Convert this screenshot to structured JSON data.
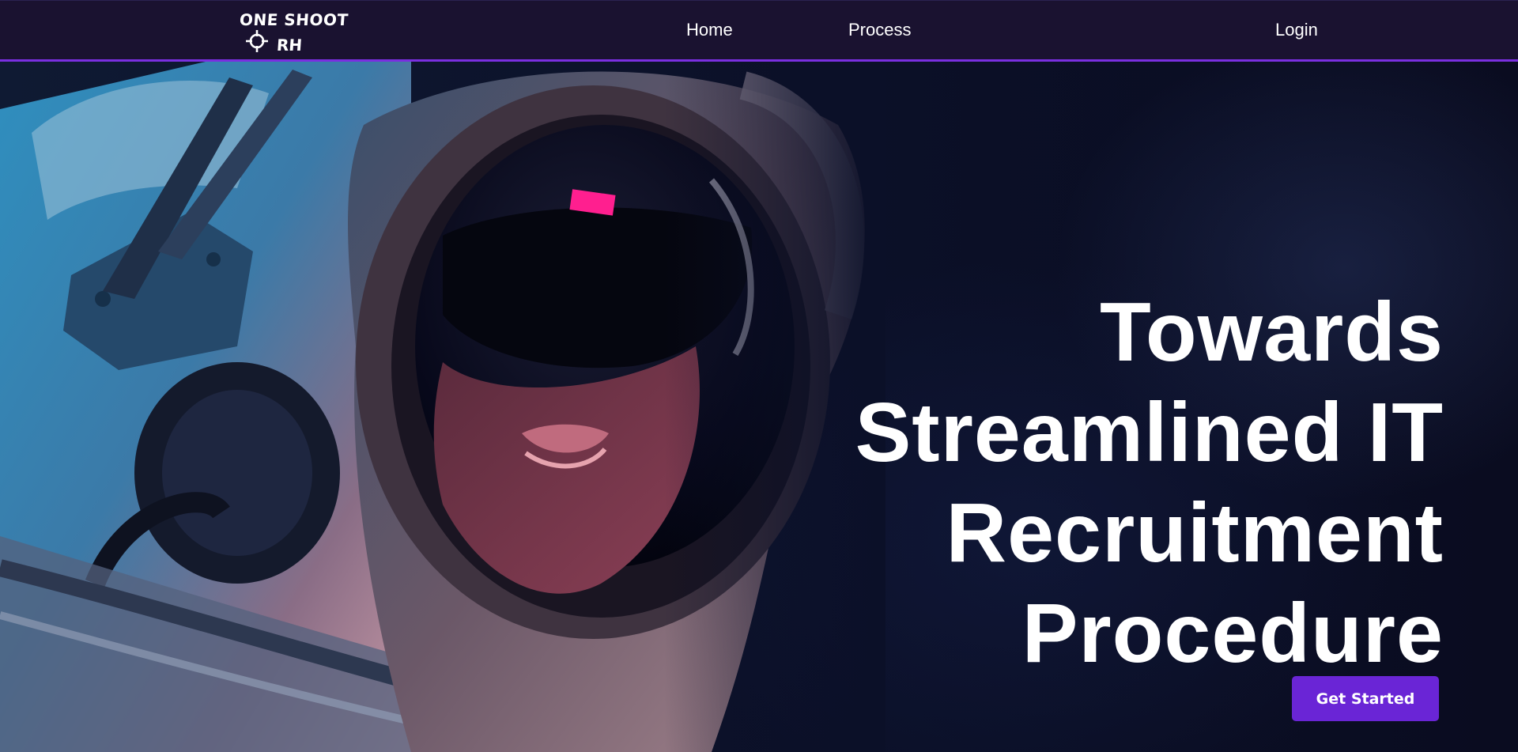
{
  "brand": {
    "line1": "ONE SHOOT",
    "line2": "RH",
    "accent_color": "#7a2fe0"
  },
  "nav": {
    "home": "Home",
    "process": "Process",
    "login": "Login"
  },
  "hero": {
    "headline_lines": [
      "Towards",
      "Streamlined IT",
      "Recruitment",
      "Procedure"
    ],
    "cta_label": "Get Started",
    "cta_color": "#6a25d6",
    "image_icon": "astronaut-helmet-photo"
  }
}
